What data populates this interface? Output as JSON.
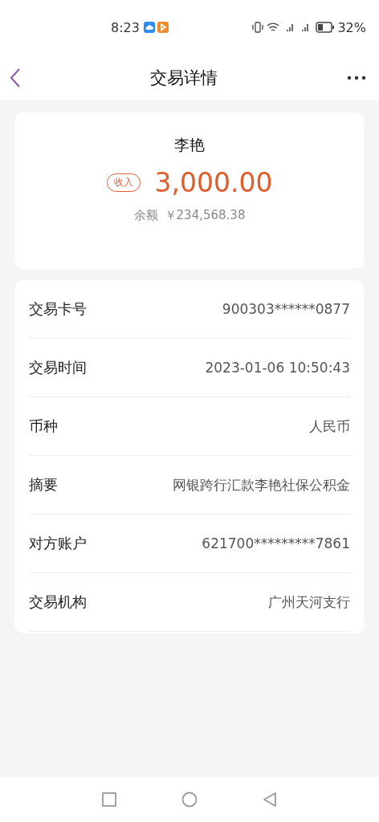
{
  "status_bar": {
    "time": "8:23",
    "battery": "32%"
  },
  "header": {
    "title": "交易详情"
  },
  "summary": {
    "name": "李艳",
    "tag": "收入",
    "amount": "3,000.00",
    "balance_label": "余额",
    "balance": "￥234,568.38"
  },
  "details": [
    {
      "label": "交易卡号",
      "value": "900303******0877"
    },
    {
      "label": "交易时间",
      "value": "2023-01-06 10:50:43"
    },
    {
      "label": "币种",
      "value": "人民币"
    },
    {
      "label": "摘要",
      "value": "网银跨行汇款李艳社保公积金"
    },
    {
      "label": "对方账户",
      "value": "621700*********7861"
    },
    {
      "label": "交易机构",
      "value": "广州天河支行"
    }
  ]
}
